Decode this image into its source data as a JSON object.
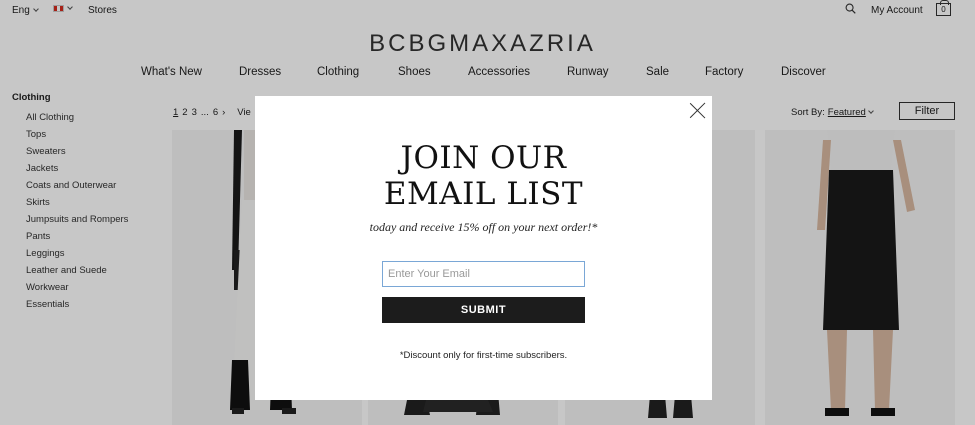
{
  "utility": {
    "language": "Eng",
    "country_flag": "canada-flag-icon",
    "stores": "Stores",
    "account": "My Account",
    "bag_count": "0"
  },
  "brand": {
    "logo": "BCBGMAXAZRIA"
  },
  "nav": [
    "What's New",
    "Dresses",
    "Clothing",
    "Shoes",
    "Accessories",
    "Runway",
    "Sale",
    "Factory",
    "Discover"
  ],
  "sidebar": {
    "title": "Clothing",
    "items": [
      "All Clothing",
      "Tops",
      "Sweaters",
      "Jackets",
      "Coats and Outerwear",
      "Skirts",
      "Jumpsuits and Rompers",
      "Pants",
      "Leggings",
      "Leather and Suede",
      "Workwear",
      "Essentials"
    ]
  },
  "pagination": {
    "pages": [
      "1",
      "2",
      "3"
    ],
    "ellipsis": "...",
    "last": "6",
    "next": "›",
    "view": "Vie"
  },
  "sort": {
    "label": "Sort By:",
    "value": "Featured"
  },
  "filter_label": "Filter",
  "modal": {
    "headline_line1": "JOIN OUR",
    "headline_line2": "EMAIL LIST",
    "subtext": "today and receive 15% off on your next order!*",
    "email_placeholder": "Enter Your Email",
    "email_value": "",
    "submit_label": "SUBMIT",
    "disclaimer": "*Discount only for first-time subscribers."
  },
  "colors": {
    "overlay": "#000000",
    "button": "#1c1c1c",
    "input_border": "#7aa7d6"
  }
}
